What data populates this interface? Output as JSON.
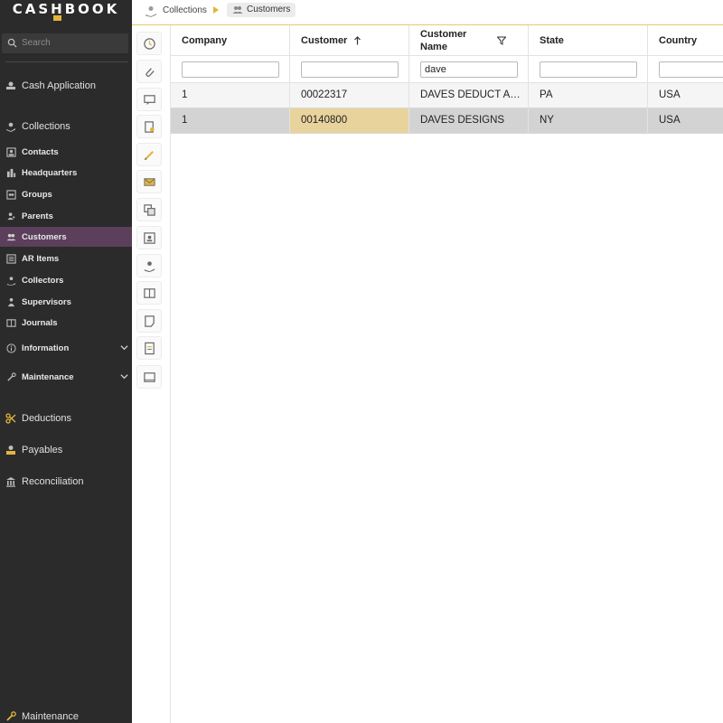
{
  "app": {
    "logo_text": "CASHBOOK",
    "brand_color": "#e2b53a",
    "sidebar_bg": "#2b2b2b",
    "active_bg": "#5b3f5b"
  },
  "search": {
    "label": "Search",
    "icon": "search-icon"
  },
  "sidebar": {
    "top_items": [
      {
        "label": "Cash Application",
        "icon": "cash-application-icon"
      },
      {
        "label": "Collections",
        "icon": "collections-icon"
      }
    ],
    "collections_items": [
      {
        "label": "Contacts",
        "icon": "contacts-icon",
        "active": false
      },
      {
        "label": "Headquarters",
        "icon": "headquarters-icon",
        "active": false
      },
      {
        "label": "Groups",
        "icon": "groups-icon",
        "active": false
      },
      {
        "label": "Parents",
        "icon": "parents-icon",
        "active": false
      },
      {
        "label": "Customers",
        "icon": "customers-icon",
        "active": true
      },
      {
        "label": "AR Items",
        "icon": "ar-items-icon",
        "active": false
      },
      {
        "label": "Collectors",
        "icon": "collectors-icon",
        "active": false
      },
      {
        "label": "Supervisors",
        "icon": "supervisors-icon",
        "active": false
      },
      {
        "label": "Journals",
        "icon": "journals-icon",
        "active": false
      },
      {
        "label": "Information",
        "icon": "information-icon",
        "expandable": true
      },
      {
        "label": "Maintenance",
        "icon": "maintenance-icon",
        "expandable": true
      }
    ],
    "bottom_items": [
      {
        "label": "Deductions",
        "icon": "deductions-icon"
      },
      {
        "label": "Payables",
        "icon": "payables-icon"
      },
      {
        "label": "Reconciliation",
        "icon": "reconciliation-icon"
      }
    ],
    "footer_item": {
      "label": "Maintenance",
      "icon": "wrench-icon"
    }
  },
  "breadcrumb": {
    "parent": "Collections",
    "current": "Customers"
  },
  "toolbar_icons": [
    "history-icon",
    "attachment-icon",
    "comment-icon",
    "document-icon",
    "edit-icon",
    "mail-icon",
    "copy-icon",
    "contact-card-icon",
    "collector-icon",
    "book-icon",
    "note-icon",
    "report-icon",
    "message-icon"
  ],
  "grid": {
    "columns": [
      {
        "label": "Company"
      },
      {
        "label": "Customer",
        "sort": "ascending"
      },
      {
        "label": "Customer Name",
        "filtered": true
      },
      {
        "label": "State"
      },
      {
        "label": "Country"
      }
    ],
    "filters": [
      "",
      "",
      "dave",
      "",
      ""
    ],
    "rows": [
      {
        "cells": [
          "1",
          "00022317",
          "DAVES DEDUCT ACCOUNT",
          "PA",
          "USA"
        ],
        "selected": false
      },
      {
        "cells": [
          "1",
          "00140800",
          "DAVES DESIGNS",
          "NY",
          "USA"
        ],
        "selected": true
      }
    ],
    "highlight_color": "#e8d39c",
    "selected_row_color": "#d3d3d3"
  }
}
